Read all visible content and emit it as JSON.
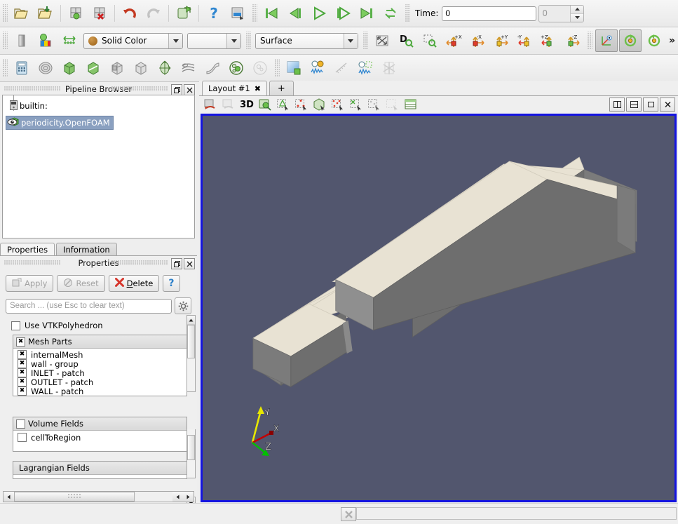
{
  "toolbars": {
    "file": [
      {
        "name": "open-file-icon",
        "tip": "Open"
      },
      {
        "name": "open-recent-icon",
        "tip": "Open Recent"
      },
      {
        "name": "save-state-icon",
        "tip": "Save State"
      },
      {
        "name": "load-state-icon",
        "tip": "Load State"
      },
      {
        "name": "undo-icon",
        "tip": "Undo"
      },
      {
        "name": "redo-icon",
        "tip": "Redo"
      },
      {
        "name": "connect-server-icon",
        "tip": "Connect"
      },
      {
        "name": "help-icon",
        "tip": "Help"
      },
      {
        "name": "save-screenshot-icon",
        "tip": "Save Screenshot"
      }
    ],
    "vcr": [
      {
        "name": "first-frame-icon",
        "tip": "First Frame"
      },
      {
        "name": "previous-frame-icon",
        "tip": "Previous Frame"
      },
      {
        "name": "play-icon",
        "tip": "Play"
      },
      {
        "name": "next-frame-icon",
        "tip": "Next Frame"
      },
      {
        "name": "last-frame-icon",
        "tip": "Last Frame"
      },
      {
        "name": "loop-icon",
        "tip": "Loop"
      }
    ],
    "time": {
      "label": "Time:",
      "value": "0",
      "frame_index": "0"
    },
    "representation": {
      "color_by_label": "Solid Color",
      "color_map_label": "",
      "representation_label": "Surface",
      "scalar_bar_icon": "edit-color-map-icon",
      "rescale_icon": "rescale-range-icon",
      "rescale_custom_icon": "rescale-custom-range-icon"
    },
    "camera": [
      {
        "name": "reset-camera-icon",
        "label": ""
      },
      {
        "name": "zoom-to-data-icon",
        "label": "D"
      },
      {
        "name": "zoom-to-box-icon",
        "label": ""
      },
      {
        "name": "plus-x-icon",
        "label": "+X"
      },
      {
        "name": "minus-x-icon",
        "label": "-X"
      },
      {
        "name": "plus-y-icon",
        "label": "+Y"
      },
      {
        "name": "minus-y-icon",
        "label": "-Y"
      },
      {
        "name": "plus-z-icon",
        "label": "+Z"
      },
      {
        "name": "minus-z-icon",
        "label": "-Z"
      },
      {
        "name": "rotate-axis-icon",
        "label": ""
      },
      {
        "name": "rotate-90-ccw-icon",
        "label": ""
      },
      {
        "name": "rotate-90-cw-icon",
        "label": ""
      }
    ],
    "overflow_label": "»",
    "filters": [
      {
        "name": "calculator-filter-icon"
      },
      {
        "name": "contour-filter-icon"
      },
      {
        "name": "clip-filter-icon"
      },
      {
        "name": "slice-filter-icon"
      },
      {
        "name": "threshold-filter-icon"
      },
      {
        "name": "extract-subset-filter-icon"
      },
      {
        "name": "glyph-filter-icon"
      },
      {
        "name": "stream-tracer-filter-icon"
      },
      {
        "name": "warp-filter-icon"
      },
      {
        "name": "group-datasets-filter-icon"
      },
      {
        "name": "extract-level-filter-icon"
      },
      {
        "name": "render-view-icon"
      },
      {
        "name": "quartile-chart-view-icon"
      },
      {
        "name": "plot-over-line-icon"
      },
      {
        "name": "plot-selection-over-time-icon"
      },
      {
        "name": "connectivity-filter-icon"
      }
    ]
  },
  "pipeline_browser": {
    "title": "Pipeline Browser",
    "float_icon": "float-panel-icon",
    "close_icon": "close-panel-icon",
    "items": [
      {
        "label": "builtin:",
        "icon": "server-icon",
        "selected": false,
        "visible": false
      },
      {
        "label": "periodicity.OpenFOAM",
        "icon": "source-geometry-icon",
        "selected": true,
        "visible": true
      }
    ]
  },
  "panel_tabs": [
    {
      "label": "Properties",
      "active": true
    },
    {
      "label": "Information",
      "active": false
    }
  ],
  "properties": {
    "title": "Properties",
    "float_icon": "float-panel-icon",
    "close_icon": "close-panel-icon",
    "buttons": {
      "apply": "Apply",
      "reset": "Reset",
      "delete": "Delete",
      "help": "?"
    },
    "search_placeholder": "Search ... (use Esc to clear text)",
    "search_value": "",
    "gear_icon": "settings-gear-icon",
    "use_vtk_polyhedron": {
      "label": "Use VTKPolyhedron",
      "checked": false
    },
    "mesh_parts": {
      "header": "Mesh Parts",
      "header_checked": true,
      "items": [
        {
          "label": "internalMesh",
          "checked": true
        },
        {
          "label": "wall - group",
          "checked": true
        },
        {
          "label": "INLET - patch",
          "checked": true
        },
        {
          "label": "OUTLET - patch",
          "checked": true
        },
        {
          "label": "WALL - patch",
          "checked": true
        }
      ]
    },
    "volume_fields": {
      "header": "Volume Fields",
      "header_checked": false,
      "items": [
        {
          "label": "cellToRegion",
          "checked": false
        }
      ]
    },
    "lagrangian_fields": {
      "header": "Lagrangian Fields",
      "items": []
    }
  },
  "layout": {
    "tabs": [
      {
        "label": "Layout #1",
        "close": "✖",
        "active": true
      },
      {
        "label": "+",
        "active": false
      }
    ],
    "view_toolbar": [
      {
        "name": "undo-camera-icon"
      },
      {
        "name": "redo-camera-icon"
      },
      {
        "name": "view-type-label",
        "label": "3D"
      },
      {
        "name": "interactive-select-icon"
      },
      {
        "name": "select-cells-on-icon"
      },
      {
        "name": "select-points-on-icon"
      },
      {
        "name": "select-cells-through-icon"
      },
      {
        "name": "select-points-through-icon"
      },
      {
        "name": "select-block-icon"
      },
      {
        "name": "hover-points-icon"
      },
      {
        "name": "clear-selection-icon"
      },
      {
        "name": "spreadsheet-icon"
      }
    ],
    "view_controls": [
      {
        "name": "split-horizontal-button",
        "glyph": "▥"
      },
      {
        "name": "split-vertical-button",
        "glyph": "▤"
      },
      {
        "name": "maximize-view-button",
        "glyph": "□"
      },
      {
        "name": "close-view-button",
        "glyph": "✕"
      }
    ]
  },
  "render_view": {
    "background_color": "#52566e",
    "active_border_color": "#1414e0",
    "mesh": {
      "top_face_color": "#e8e2d3",
      "side_face_color": "#6e6e6e",
      "front_face_color": "#7b7b7b",
      "edge_color": "#c9c4b8"
    },
    "orientation_axes": {
      "x_label": "X",
      "x_color": "#c40000",
      "y_label": "Y",
      "y_color": "#e8e800",
      "z_label": "Z",
      "z_color": "#00c000"
    }
  },
  "status_bar": {
    "button_icon": "progress-abort-icon",
    "message": ""
  }
}
